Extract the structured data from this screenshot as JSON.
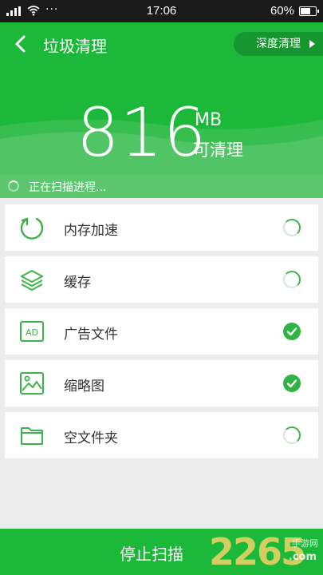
{
  "status": {
    "time": "17:06",
    "battery": "60%",
    "dots": "···"
  },
  "header": {
    "title": "垃圾清理",
    "deep_clean_label": "深度清理",
    "amount": "816",
    "unit": "MB",
    "sub": "可清理"
  },
  "scan": {
    "text": "正在扫描进程..."
  },
  "items": [
    {
      "label": "内存加速",
      "icon": "memory-boost-icon",
      "state": "loading"
    },
    {
      "label": "缓存",
      "icon": "cache-layers-icon",
      "state": "loading"
    },
    {
      "label": "广告文件",
      "icon": "ad-file-icon",
      "state": "done"
    },
    {
      "label": "缩略图",
      "icon": "thumbnail-image-icon",
      "state": "done"
    },
    {
      "label": "空文件夹",
      "icon": "folder-icon",
      "state": "loading"
    }
  ],
  "bottom": {
    "stop_label": "停止扫描",
    "watermark": "2265",
    "watermark_sub": "手游网",
    "watermark_domain": ".com"
  },
  "colors": {
    "primary": "#1bb83a",
    "light": "#5cc76f",
    "icon": "#3ab54a"
  }
}
